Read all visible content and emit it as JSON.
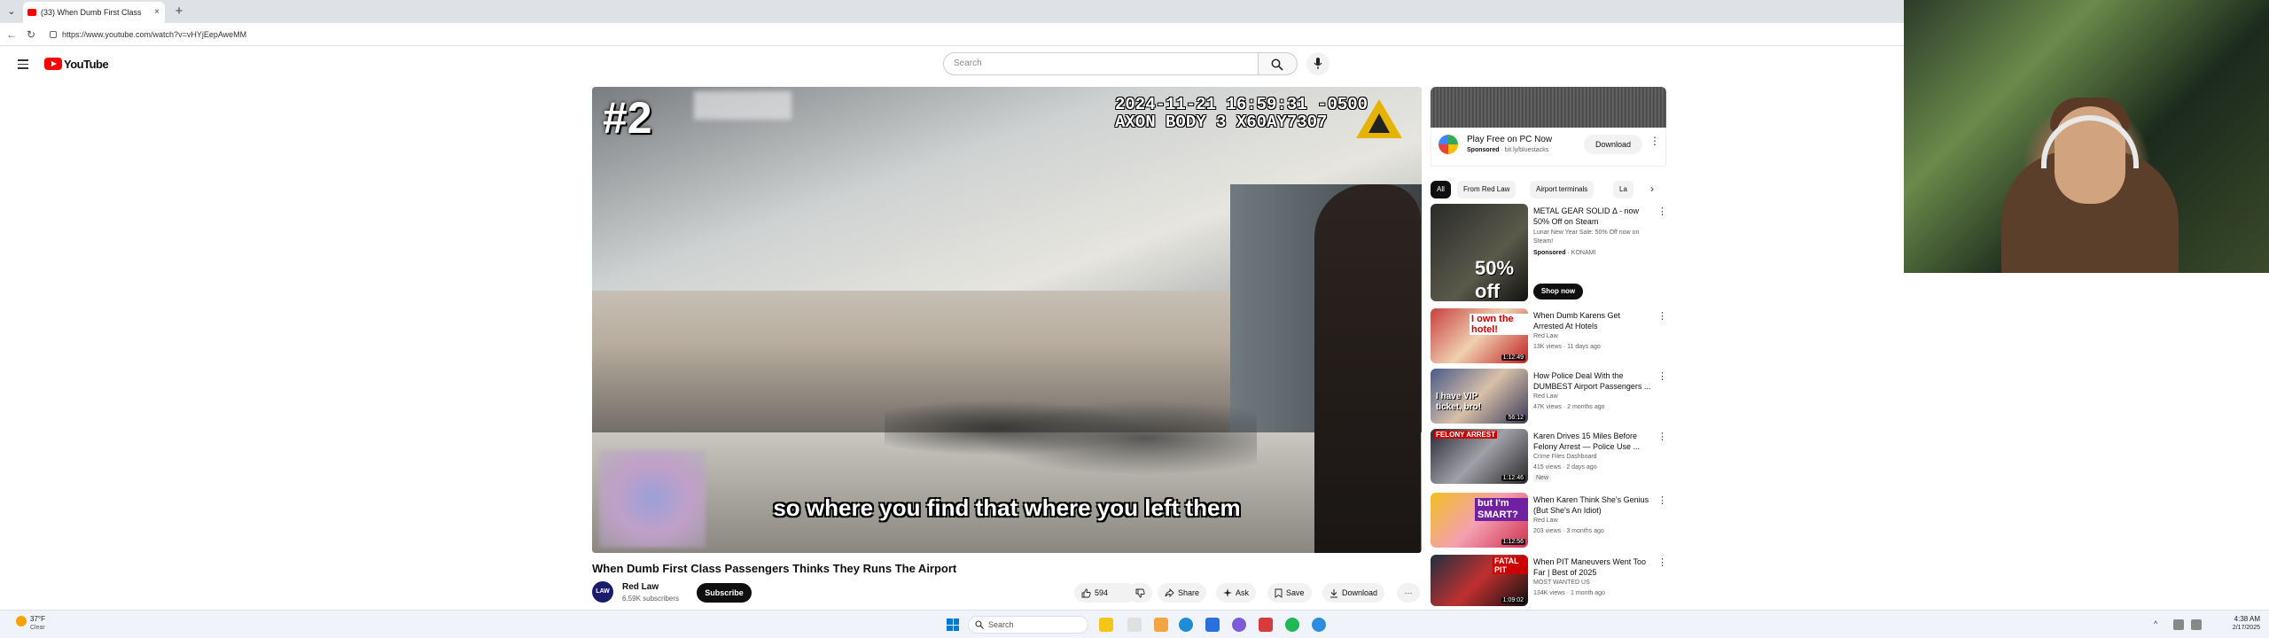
{
  "browser": {
    "tab_title": "(33) When Dumb First Class",
    "tab_close": "×",
    "new_tab": "+",
    "url": "https://www.youtube.com/watch?v=vHYjEepAweMM"
  },
  "header": {
    "logo_text": "YouTube",
    "search_placeholder": "Search"
  },
  "player": {
    "rank_overlay": "#2",
    "timestamp_line1": "2024-11-21 16:59:31 -0500",
    "timestamp_line2": "AXON BODY 3 X60AY7307",
    "subtitle": "so where you find that where you left them"
  },
  "video": {
    "title": "When Dumb First Class Passengers Thinks They Runs The Airport",
    "channel_name": "Red Law",
    "channel_avatar": "LAW",
    "subscribers": "6.59K subscribers",
    "subscribe_label": "Subscribe",
    "like_count": "594",
    "share_label": "Share",
    "ask_label": "Ask",
    "save_label": "Save",
    "download_label": "Download",
    "more_label": "···"
  },
  "ad": {
    "title": "Play Free on PC Now",
    "sponsored": "Sponsored",
    "advertiser": "· bit.ly/bluestacks",
    "download_label": "Download",
    "more": "⋮"
  },
  "chips": [
    {
      "label": "All"
    },
    {
      "label": "From Red Law"
    },
    {
      "label": "Airport terminals"
    },
    {
      "label": "La"
    }
  ],
  "recommendations": [
    {
      "title": "METAL GEAR SOLID Δ - now 50% Off on Steam",
      "description": "Lunar New Year Sale: 50% Off now on Steam!",
      "badge": "Sponsored",
      "channel": "· KONAMI",
      "thumb_text": "50% off",
      "action": "Shop now"
    },
    {
      "title": "When Dumb Karens Get Arrested At Hotels",
      "channel": "Red Law",
      "meta": "13K views · 11 days ago",
      "duration": "1:12:49",
      "thumb_text": "I own the hotel!"
    },
    {
      "title": "How Police Deal With the DUMBEST Airport Passengers ...",
      "channel": "Red Law",
      "meta": "47K views · 2 months ago",
      "duration": "56:12",
      "thumb_text": "I have VIP ticket, bro!"
    },
    {
      "title": "Karen Drives 15 Miles Before Felony Arrest — Police Use ...",
      "channel": "Crime Files Dashboard",
      "meta": "415 views · 2 days ago",
      "badge": "New",
      "duration": "1:12:46",
      "thumb_text": "FELONY ARREST"
    },
    {
      "title": "When Karen Think She's Genius (But She's An Idiot)",
      "channel": "Red Law",
      "meta": "203 views · 3 months ago",
      "duration": "1:12:56",
      "thumb_text": "but I'm SMART?"
    },
    {
      "title": "When PIT Maneuvers Went Too Far | Best of 2025",
      "channel": "MOST WANTED US",
      "meta": "134K views · 1 month ago",
      "duration": "1:09:02",
      "thumb_text": "FATAL PIT"
    }
  ],
  "taskbar": {
    "temperature": "37°F",
    "condition": "Clear",
    "search_label": "Search",
    "time": "4:38 AM",
    "date": "2/17/2025"
  },
  "colors": {
    "yt_red": "#ff0000",
    "dark": "#0f0f0f",
    "chip_bg": "#f2f2f2",
    "muted": "#606060"
  }
}
